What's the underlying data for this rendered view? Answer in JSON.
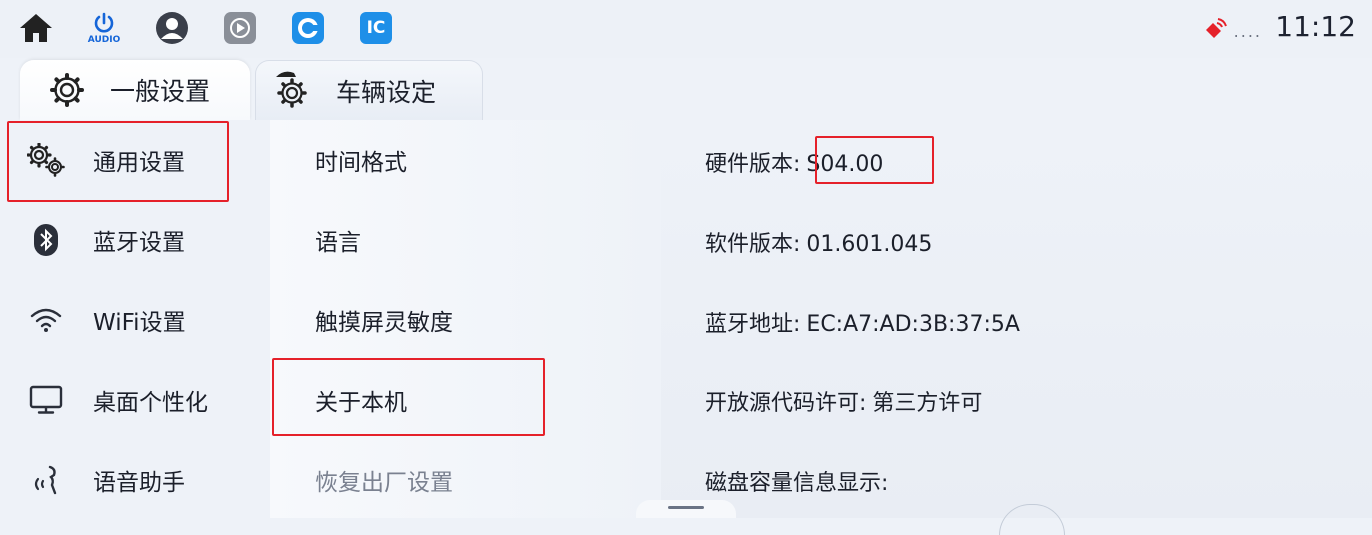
{
  "topbar": {
    "audio_label": "AUDIO",
    "app_icon_label": "IC",
    "time": "11:12",
    "dots": "....",
    "colors": {
      "power": "#1565d8",
      "app_blue": "#1e8fe8",
      "alert_red": "#e5212a"
    }
  },
  "tabs": [
    {
      "label": "一般设置",
      "active": true
    },
    {
      "label": "车辆设定",
      "active": false
    }
  ],
  "left_menu": [
    {
      "label": "通用设置",
      "icon": "gears-icon",
      "selected": true
    },
    {
      "label": "蓝牙设置",
      "icon": "bluetooth-icon"
    },
    {
      "label": "WiFi设置",
      "icon": "wifi-icon"
    },
    {
      "label": "桌面个性化",
      "icon": "monitor-icon"
    },
    {
      "label": "语音助手",
      "icon": "voice-assistant-icon"
    }
  ],
  "middle_menu": [
    {
      "label": "时间格式"
    },
    {
      "label": "语言"
    },
    {
      "label": "触摸屏灵敏度"
    },
    {
      "label": "关于本机",
      "selected": true
    },
    {
      "label": "恢复出厂设置"
    }
  ],
  "about": {
    "hardware_label": "硬件版本:",
    "hardware_value": "S04.00",
    "software_label": "软件版本:",
    "software_value": "01.601.045",
    "bt_label": "蓝牙地址:",
    "bt_value": "EC:A7:AD:3B:37:5A",
    "license_label": "开放源代码许可:",
    "license_value": "第三方许可",
    "disk_label": "磁盘容量信息显示:"
  },
  "highlight_color": "#e5212a"
}
